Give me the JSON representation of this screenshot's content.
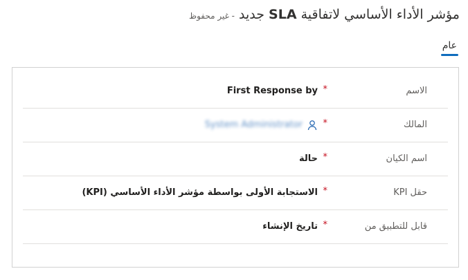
{
  "header": {
    "title_prefix": "مؤشر الأداء الأساسي لاتفاقية",
    "title_sla": "SLA",
    "title_suffix": "جديد",
    "save_status": "- غير محفوظ"
  },
  "tabs": [
    {
      "label": "عام",
      "active": true
    }
  ],
  "form": {
    "rows": [
      {
        "label": "الاسم",
        "required": "*",
        "value": "First Response by"
      },
      {
        "label": "المالك",
        "required": "*",
        "value": "System Administrator",
        "icon": "person-icon"
      },
      {
        "label": "اسم الكيان",
        "required": "*",
        "value": "حالة"
      },
      {
        "label": "حقل KPI",
        "required": "*",
        "value": "الاستجابة الأولى بواسطة مؤشر الأداء الأساسي (KPI)"
      },
      {
        "label": "قابل للتطبيق من",
        "required": "*",
        "value": "تاريخ الإنشاء"
      }
    ]
  },
  "colors": {
    "accent": "#0f6cbd",
    "required": "#c50f1f",
    "lookup": "#2f6eb5",
    "border": "#d1d1d1"
  }
}
